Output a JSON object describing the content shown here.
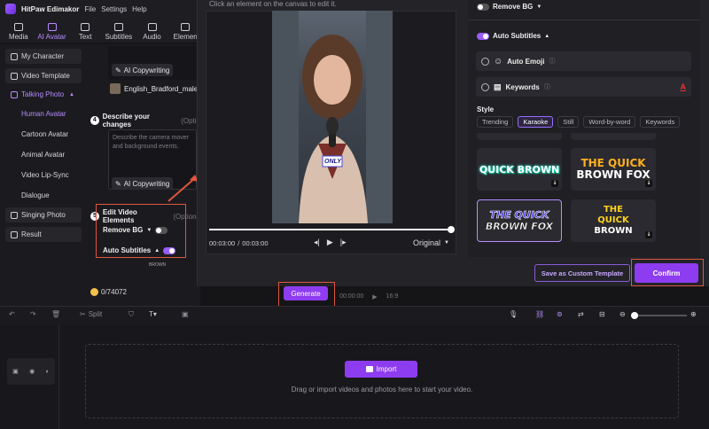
{
  "app": {
    "title": "HitPaw Edimakor",
    "menu": [
      "File",
      "Settings",
      "Help"
    ]
  },
  "top_tabs": [
    {
      "label": "Media",
      "active": false
    },
    {
      "label": "AI Avatar",
      "active": true
    },
    {
      "label": "Text",
      "active": false
    },
    {
      "label": "Subtitles",
      "active": false
    },
    {
      "label": "Audio",
      "active": false
    },
    {
      "label": "Elemen",
      "active": false
    }
  ],
  "sidebar": {
    "items": [
      {
        "label": "My Character",
        "icon": "user-icon"
      },
      {
        "label": "Video Template",
        "icon": "video-icon"
      },
      {
        "label": "Talking Photo",
        "icon": "photo-icon",
        "active": true
      }
    ],
    "subitems": [
      {
        "label": "Human Avatar",
        "active": true
      },
      {
        "label": "Cartoon Avatar"
      },
      {
        "label": "Animal Avatar"
      },
      {
        "label": "Video Lip-Sync"
      },
      {
        "label": "Dialogue"
      }
    ],
    "bottom_items": [
      {
        "label": "Singing Photo",
        "icon": "music-photo-icon"
      },
      {
        "label": "Result",
        "icon": "result-icon"
      }
    ]
  },
  "mid_panel": {
    "copy_btn_1": "AI Copywriting",
    "voice_name": "English_Bradford_male",
    "step4_num": "4",
    "step4_title": "Describe your changes",
    "step4_hint": "(Optio",
    "describe_placeholder": "Describe the camera mover and background events.",
    "copy_btn_2": "AI Copywriting",
    "step5_num": "5",
    "step5_title": "Edit Video Elements",
    "step5_hint": "(Optiona",
    "remove_bg_label": "Remove BG",
    "auto_subtitles_label": "Auto Subtitles",
    "preview_word": "BROWN",
    "credits": "0/74072",
    "generate_label": "Generate"
  },
  "modal": {
    "hint": "Click an element on the canvas to edit it.",
    "sticker_text": "ONLY",
    "time_current": "00:03:00",
    "time_sep": "/",
    "time_total": "00:03:00",
    "ratio_label": "Original",
    "progress": 1.0,
    "save_template_label": "Save as Custom Template",
    "confirm_label": "Confirm"
  },
  "right_panel": {
    "remove_bg": {
      "label": "Remove BG",
      "on": false
    },
    "auto_subtitles": {
      "label": "Auto Subtitles",
      "on": true
    },
    "auto_emoji": {
      "label": "Auto Emoji",
      "checked": false
    },
    "keywords": {
      "label": "Keywords",
      "checked": false,
      "color_glyph": "A"
    },
    "style_label": "Style",
    "style_tabs": [
      {
        "label": "Trending",
        "active": false
      },
      {
        "label": "Karaoke",
        "active": true
      },
      {
        "label": "Still",
        "active": false
      },
      {
        "label": "Word-by-word",
        "active": false
      },
      {
        "label": "Keywords",
        "active": false
      }
    ],
    "cards": [
      {
        "lines": [
          "QUICK BROWN"
        ],
        "selected": false
      },
      {
        "lines": [
          "THE QUICK",
          "BROWN FOX"
        ],
        "selected": false
      },
      {
        "lines": [
          "THE QUICK",
          "BROWN FOX"
        ],
        "selected": true
      },
      {
        "lines": [
          "THE",
          "QUICK",
          "BROWN"
        ],
        "selected": false
      }
    ]
  },
  "timeline": {
    "toolbar": {
      "split_label": "Split",
      "time_display": "00:00:00",
      "ratio": "16:9"
    },
    "import_label": "Import",
    "drop_hint": "Drag or import videos and photos here to start your video."
  },
  "colors": {
    "accent": "#9a5cff",
    "highlight": "#e0553f",
    "confirm": "#8e3cf0"
  }
}
